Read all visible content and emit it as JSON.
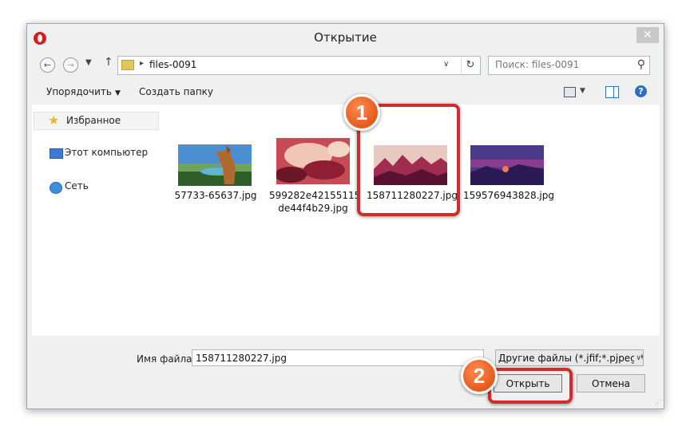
{
  "window": {
    "title": "Открытие",
    "close_glyph": "✕"
  },
  "nav": {
    "back_glyph": "←",
    "forward_glyph": "→",
    "recent_glyph": "▼",
    "up_glyph": "↑",
    "address": {
      "arrow": "▸",
      "path": "files-0091",
      "dropdown_glyph": "∨",
      "refresh_glyph": "↻"
    },
    "search": {
      "placeholder": "Поиск: files-0091",
      "icon_glyph": "⚲"
    }
  },
  "toolbar": {
    "organize_label": "Упорядочить",
    "organize_arrow": "▼",
    "new_folder_label": "Создать папку",
    "view_drop_glyph": "▼",
    "help_glyph": "?"
  },
  "sidebar": {
    "items": [
      {
        "label": "Избранное",
        "icon": "star-icon",
        "icon_glyph": "★"
      },
      {
        "label": "Этот компьютер",
        "icon": "computer-icon"
      },
      {
        "label": "Сеть",
        "icon": "network-icon"
      }
    ]
  },
  "files": [
    {
      "name": "57733-65637.jpg",
      "name_line2": ""
    },
    {
      "name": "599282e42155115",
      "name_line2": "de44f4b29.jpg"
    },
    {
      "name": "158711280227.jpg",
      "name_line2": ""
    },
    {
      "name": "159576943828.jpg",
      "name_line2": ""
    }
  ],
  "bottom": {
    "filename_label": "Имя файла:",
    "filename_value": "158711280227.jpg",
    "filetype_value": "Другие файлы (*.jfif;*.pjpeg;*.j",
    "filetype_arrow": "∨",
    "open_label": "Открыть",
    "cancel_label": "Отмена"
  },
  "annotations": [
    {
      "number": "1"
    },
    {
      "number": "2"
    }
  ],
  "colors": {
    "highlight": "#d32b2b",
    "badge": "#e45a1c",
    "accent": "#3c7fb1"
  }
}
